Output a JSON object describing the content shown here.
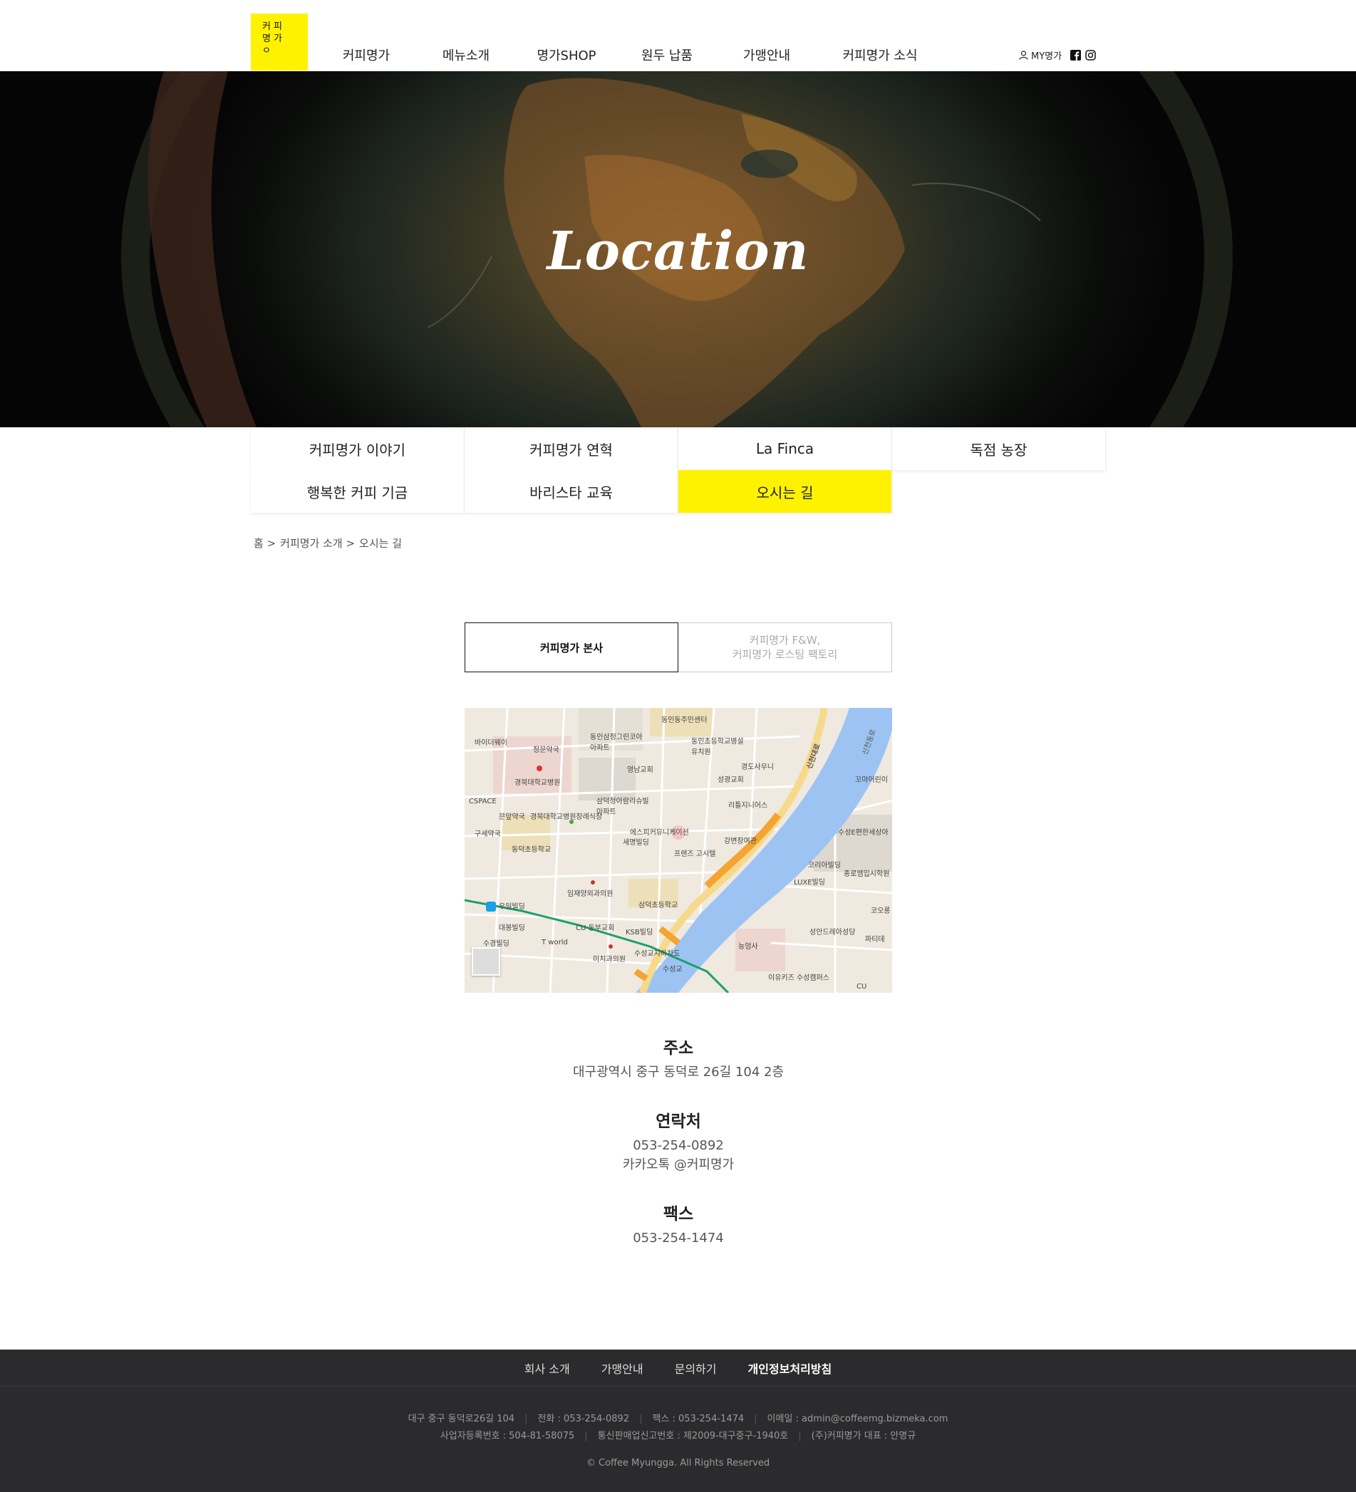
{
  "header": {
    "logo_lines": [
      "커피",
      "명가",
      "ㅇ"
    ],
    "nav": [
      "커피명가",
      "메뉴소개",
      "명가SHOP",
      "원두 납품",
      "가맹안내",
      "커피명가 소식"
    ],
    "my_label": "MY명가",
    "icons": [
      "user-icon",
      "facebook-icon",
      "instagram-icon"
    ]
  },
  "hero": {
    "title": "Location"
  },
  "subnav": {
    "items": [
      "커피명가 이야기",
      "커피명가 연혁",
      "La Finca",
      "독점 농장",
      "행복한 커피 기금",
      "바리스타 교육",
      "오시는 길"
    ],
    "active": "오시는 길"
  },
  "breadcrumb": [
    "홈 >",
    "커피명가 소개 >",
    "오시는 길"
  ],
  "location_tabs": {
    "active": "커피명가 본사",
    "inactive_line1": "커피명가 F&W,",
    "inactive_line2": "커피명가 로스팅 팩토리"
  },
  "map": {
    "labels": [
      "동인동주민센터",
      "바이더웨이",
      "정문약국",
      "동인삼정그린코아아파트",
      "동인초등학교병설유치원",
      "경도사우니",
      "성광교회",
      "영남교회",
      "경북대학교병원",
      "CSPACE",
      "삼덕청아람리슈빌아파트",
      "리틀지니어스",
      "문앞약국",
      "경북대학교병원장례식장",
      "구세약국",
      "동덕초등학교",
      "에스피커뮤니케이션",
      "세명빌딩",
      "강변장여관",
      "프렌즈 고시텔",
      "코리아빌딩",
      "종로엠입시학원",
      "수성E편한세상아",
      "LUXE빌딩",
      "임재양외과의원",
      "우일빌딩",
      "삼덕초등학교",
      "대봉빌딩",
      "CU 동부교회",
      "KSB빌딩",
      "T world",
      "수경빌딩",
      "미치과의원",
      "수성교지하차도",
      "수성교",
      "능엄사",
      "성안드레아성당",
      "이유키즈 수성캠퍼스",
      "신천대로",
      "신천동로",
      "코오롱",
      "파티데",
      "꼬마어린이",
      "CU"
    ]
  },
  "info": {
    "address_title": "주소",
    "address": "대구광역시 중구 동덕로 26길 104 2층",
    "contact_title": "연락처",
    "phone": "053-254-0892",
    "kakao": "카카오톡 @커피명가",
    "fax_title": "팩스",
    "fax": "053-254-1474"
  },
  "footer": {
    "nav": [
      "회사 소개",
      "가맹안내",
      "문의하기",
      "개인정보처리방침"
    ],
    "line1": [
      "대구 중구 동덕로26길 104",
      "전화 : 053-254-0892",
      "팩스 : 053-254-1474",
      "이메일 : admin@coffeemg.bizmeka.com"
    ],
    "line2": [
      "사업자등록번호 : 504-81-58075",
      "통신판매업신고번호 : 제2009-대구중구-1940호",
      "(주)커피명가 대표 : 안명규"
    ],
    "copyright": "© Coffee Myungga. All Rights Reserved"
  }
}
